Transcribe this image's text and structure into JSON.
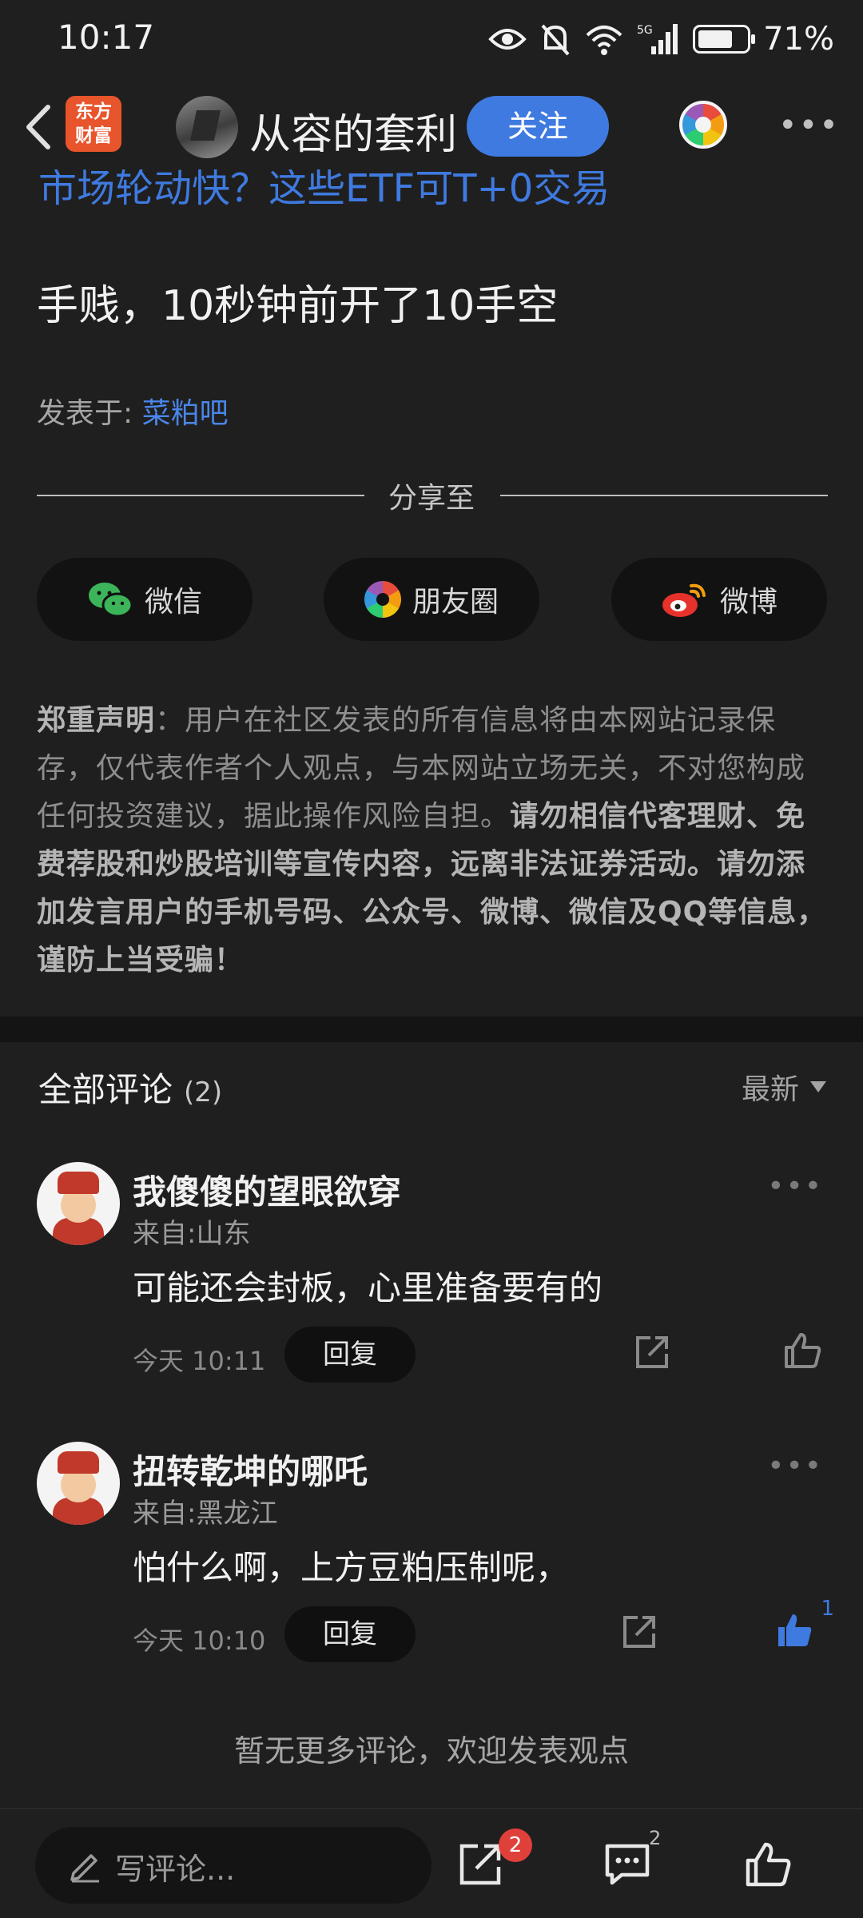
{
  "status_bar": {
    "time": "10:17",
    "battery": "71%",
    "network": "5G"
  },
  "header": {
    "logo_line1": "东方",
    "logo_line2": "财富",
    "username": "从容的套利",
    "follow_label": "关注"
  },
  "promo_peek": "市场轮动快？这些ETF可T+0交易",
  "post": {
    "text": "手贱，10秒钟前开了10手空",
    "posted_in_label": "发表于:",
    "posted_in_bar": "菜粕吧"
  },
  "share": {
    "title": "分享至",
    "wechat": "微信",
    "moments": "朋友圈",
    "weibo": "微博"
  },
  "notice": {
    "lead": "郑重声明",
    "colon": "：",
    "normal": "用户在社区发表的所有信息将由本网站记录保存，仅代表作者个人观点，与本网站立场无关，不对您构成任何投资建议，据此操作风险自担。",
    "bold": "请勿相信代客理财、免费荐股和炒股培训等宣传内容，远离非法证券活动。请勿添加发言用户的手机号码、公众号、微博、微信及QQ等信息，谨防上当受骗！"
  },
  "comments_section": {
    "title": "全部评论",
    "count": "(2)",
    "sort_label": "最新",
    "items": [
      {
        "name": "我傻傻的望眼欲穿",
        "from": "来自:山东",
        "text": "可能还会封板，心里准备要有的",
        "time": "今天 10:11",
        "reply": "回复",
        "likes": "",
        "liked": false
      },
      {
        "name": "扭转乾坤的哪吒",
        "from": "来自:黑龙江",
        "text": "怕什么啊，上方豆粕压制呢，",
        "time": "今天 10:10",
        "reply": "回复",
        "likes": "1",
        "liked": true
      }
    ],
    "no_more": "暂无更多评论，欢迎发表观点"
  },
  "bottom_bar": {
    "placeholder": "写评论...",
    "share_badge": "2",
    "comment_count": "2"
  },
  "colors": {
    "accent": "#3f7ae0",
    "background": "#1f1f1f",
    "badge": "#e0403a"
  }
}
